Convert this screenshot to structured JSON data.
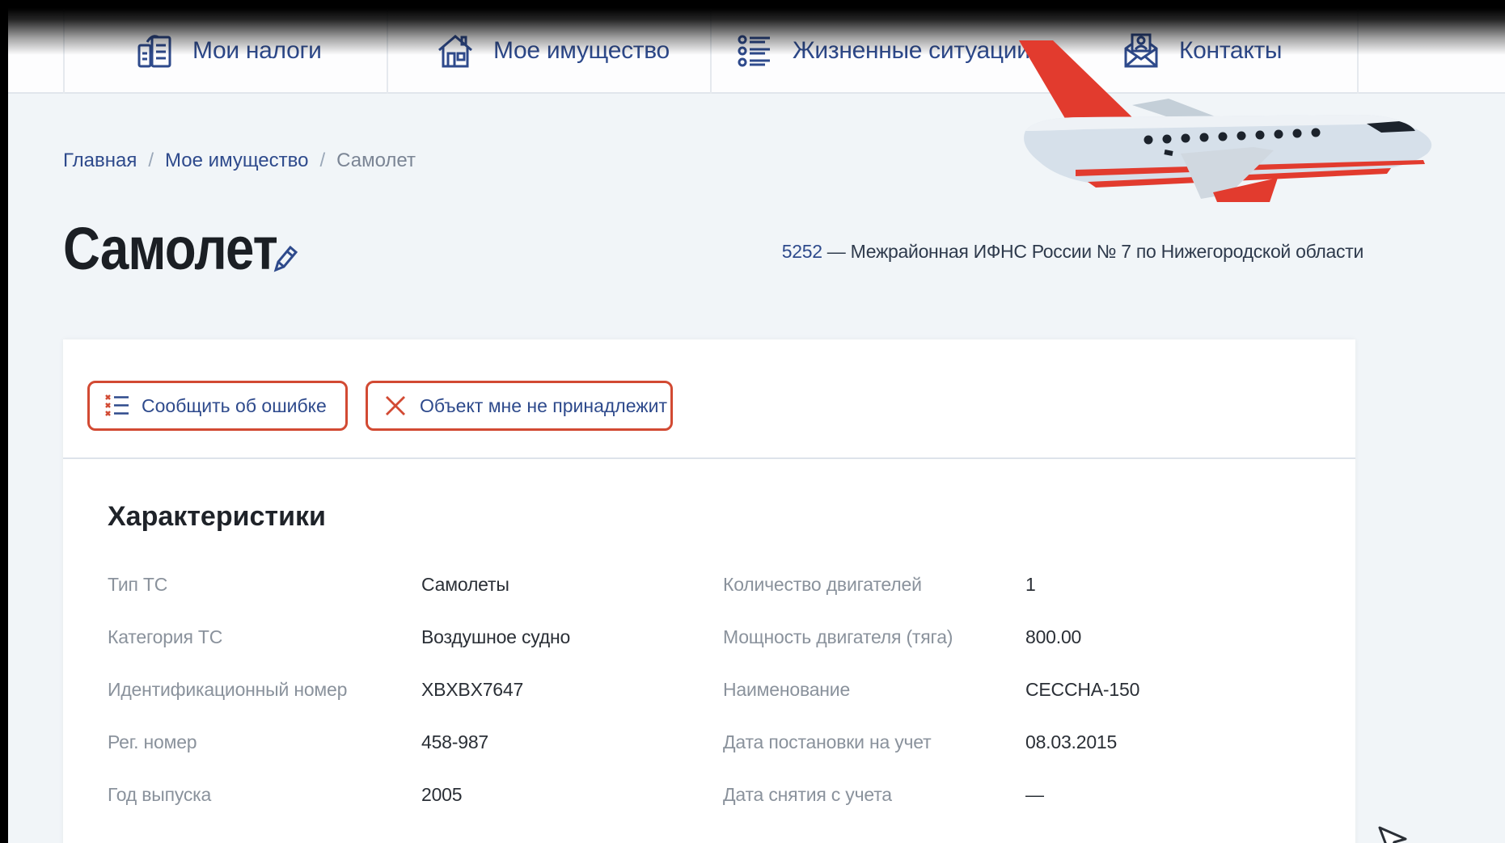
{
  "nav": {
    "items": [
      {
        "label": "Мои налоги",
        "icon": "tax-document-icon"
      },
      {
        "label": "Мое имущество",
        "icon": "house-icon"
      },
      {
        "label": "Жизненные ситуации",
        "icon": "list-icon"
      },
      {
        "label": "Контакты",
        "icon": "mail-contact-icon"
      }
    ]
  },
  "breadcrumb": {
    "home": "Главная",
    "property": "Мое имущество",
    "current": "Самолет",
    "separator": "/"
  },
  "page": {
    "title": "Самолет",
    "tax_office_code": "5252",
    "tax_office_name": " — Межрайонная ИФНС России № 7 по Нижегородской области"
  },
  "toolbar": {
    "report_error": "Сообщить об ошибке",
    "not_mine": "Объект мне не принадлежит"
  },
  "characteristics": {
    "title": "Характеристики",
    "left": [
      {
        "label": "Тип ТС",
        "value": "Самолеты"
      },
      {
        "label": "Категория ТС",
        "value": "Воздушное судно"
      },
      {
        "label": "Идентификационный номер",
        "value": "XBXBX7647"
      },
      {
        "label": "Рег. номер",
        "value": "458-987"
      },
      {
        "label": "Год выпуска",
        "value": "2005"
      }
    ],
    "right": [
      {
        "label": "Количество двигателей",
        "value": "1"
      },
      {
        "label": "Мощность двигателя (тяга)",
        "value": "800.00"
      },
      {
        "label": "Наименование",
        "value": "CECCHA-150"
      },
      {
        "label": "Дата постановки на учет",
        "value": "08.03.2015"
      },
      {
        "label": "Дата снятия с учета",
        "value": "—"
      }
    ]
  },
  "colors": {
    "accent": "#2e4a8c",
    "button_border": "#d24a33",
    "background": "#f1f5f8"
  }
}
